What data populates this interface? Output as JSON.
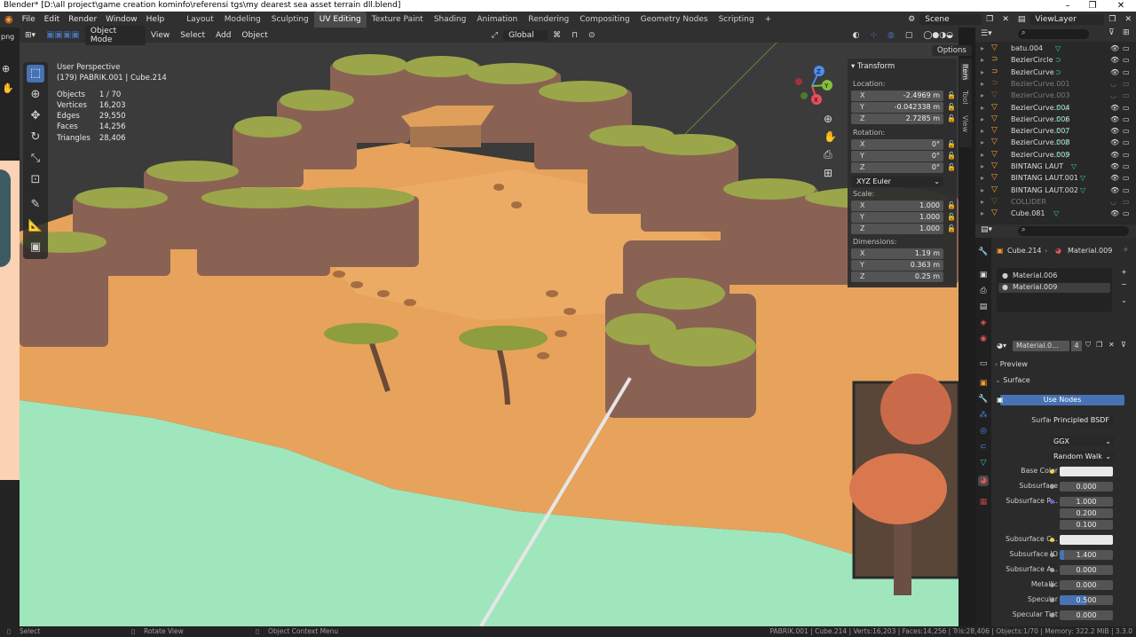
{
  "window": {
    "title": "Blender* [D:\\all project\\game creation kominfo\\referensi tgs\\my dearest sea asset terrain dll.blend]"
  },
  "topbar": {
    "menus": [
      "File",
      "Edit",
      "Render",
      "Window",
      "Help"
    ],
    "workspaces": [
      "Layout",
      "Modeling",
      "Sculpting",
      "UV Editing",
      "Texture Paint",
      "Shading",
      "Animation",
      "Rendering",
      "Compositing",
      "Geometry Nodes",
      "Scripting"
    ],
    "active_workspace": "UV Editing",
    "add_tab": "+",
    "scene": "Scene",
    "view_layer": "ViewLayer"
  },
  "viewport_header": {
    "mode": "Object Mode",
    "menus": [
      "View",
      "Select",
      "Add",
      "Object"
    ],
    "orientation": "Global",
    "options": "Options",
    "side_label": "png"
  },
  "viewport_info": {
    "line1": "User Perspective",
    "line2": "(179) PABRIK.001 | Cube.214",
    "stats": [
      {
        "label": "Objects",
        "value": "1 / 70"
      },
      {
        "label": "Vertices",
        "value": "16,203"
      },
      {
        "label": "Edges",
        "value": "29,550"
      },
      {
        "label": "Faces",
        "value": "14,256"
      },
      {
        "label": "Triangles",
        "value": "28,406"
      }
    ]
  },
  "gizmo": {
    "z": "Z",
    "y": "Y",
    "x": "X"
  },
  "npanel": {
    "section": "Transform",
    "location_label": "Location:",
    "location": {
      "x": "-2.4969 m",
      "y": "-0.042338 m",
      "z": "2.7285 m"
    },
    "rotation_label": "Rotation:",
    "rotation": {
      "x": "0°",
      "y": "0°",
      "z": "0°"
    },
    "rotation_mode": "XYZ Euler",
    "scale_label": "Scale:",
    "scale": {
      "x": "1.000",
      "y": "1.000",
      "z": "1.000"
    },
    "dimensions_label": "Dimensions:",
    "dimensions": {
      "x": "1.19 m",
      "y": "0.363 m",
      "z": "0.25 m"
    },
    "axes": {
      "x": "X",
      "y": "Y",
      "z": "Z"
    },
    "tabs": [
      "Item",
      "Tool",
      "View"
    ]
  },
  "outliner": {
    "items": [
      {
        "name": "batu.004",
        "dim": false
      },
      {
        "name": "BezierCircle",
        "dim": false
      },
      {
        "name": "BezierCurve",
        "dim": false
      },
      {
        "name": "BezierCurve.001",
        "dim": true
      },
      {
        "name": "BezierCurve.003",
        "dim": true
      },
      {
        "name": "BezierCurve.004",
        "dim": false
      },
      {
        "name": "BezierCurve.006",
        "dim": false
      },
      {
        "name": "BezierCurve.007",
        "dim": false
      },
      {
        "name": "BezierCurve.008",
        "dim": false
      },
      {
        "name": "BezierCurve.009",
        "dim": false
      },
      {
        "name": "BINTANG LAUT",
        "dim": false
      },
      {
        "name": "BINTANG LAUT.001",
        "dim": false
      },
      {
        "name": "BINTANG LAUT.002",
        "dim": false
      },
      {
        "name": "COLLIDER",
        "dim": true
      },
      {
        "name": "Cube.081",
        "dim": false
      }
    ]
  },
  "properties": {
    "breadcrumb_object": "Cube.214",
    "breadcrumb_material": "Material.009",
    "material_slots": [
      "Material.006",
      "Material.009"
    ],
    "material_name": "Material.0...",
    "user_count": "4",
    "preview_label": "Preview",
    "surface_label": "Surface",
    "use_nodes": "Use Nodes",
    "surface_row_label": "Surface",
    "surface_shader": "Principled BSDF",
    "distribution": "GGX",
    "subsurface_method": "Random Walk",
    "rows": {
      "base_color": "Base Color",
      "subsurface": "Subsurface",
      "subsurface_value": "0.000",
      "subsurface_radius": "Subsurface R...",
      "radius": [
        "1.000",
        "0.200",
        "0.100"
      ],
      "subsurface_color": "Subsurface C...",
      "subsurface_ior": "Subsurface IO",
      "subsurface_ior_value": "1.400",
      "subsurface_aniso": "Subsurface A...",
      "subsurface_aniso_value": "0.000",
      "metallic": "Metallic",
      "metallic_value": "0.000",
      "specular": "Specular",
      "specular_value": "0.500",
      "specular_tint": "Specular Tint",
      "specular_tint_value": "0.000"
    }
  },
  "statusbar": {
    "select": "Select",
    "rotate": "Rotate View",
    "context": "Object Context Menu",
    "info": "PABRIK.001 | Cube.214 | Verts:16,203 | Faces:14,256 | Tris:28,406 | Objects:1/70 | Memory: 322.2 MiB | 3.3.0"
  },
  "colors": {
    "accent": "#4772b3",
    "sand": "#e8a35a",
    "sea": "#9ee6bd",
    "rock": "#8a6253",
    "grass": "#9aa54a",
    "object_orange": "#ffa033"
  }
}
